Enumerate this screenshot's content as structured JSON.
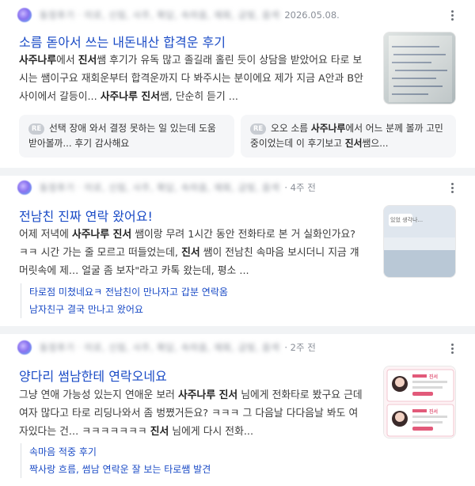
{
  "results": [
    {
      "meta_blurred": "동정후기 · 미로, 신림, 사주, 확답, 속마음, 재회, 금빛, 음색",
      "date": "2026.05.08.",
      "title": "소름 돋아서 쓰는 내돈내산 합격운 후기",
      "snippet": [
        {
          "b": "사주나루"
        },
        {
          "t": "에서 "
        },
        {
          "b": "진서"
        },
        {
          "t": "쌤 후기가 유독 많고 졸길래 홀린 듯이 상담을 받았어요 타로 보시는 쌤이구요 재회운부터 합격운까지 다 봐주시는 분이에요 제가 지금 A안과 B안 사이에서 갈등이... "
        },
        {
          "b": "사주나루 진서"
        },
        {
          "t": "쌤, 단순히 듣기 ..."
        }
      ],
      "replies": [
        {
          "tag": "RE",
          "parts": [
            {
              "t": "선택 장애 와서 결정 못하는 일 있는데 도움 받아볼까... 후기 감사해요"
            }
          ]
        },
        {
          "tag": "RE",
          "parts": [
            {
              "t": "오오 소름 "
            },
            {
              "b": "사주나루"
            },
            {
              "t": "에서 어느 분께 볼까 고민 중이었는데 이 후기보고 "
            },
            {
              "b": "진서"
            },
            {
              "t": "쌤으..."
            }
          ]
        }
      ]
    },
    {
      "meta_blurred": "동정후기 · 미로, 신림, 사주, 확답, 속마음, 재회, 금빛, 음색",
      "date": "· 4주 전",
      "title": "전남친 진짜 연락 왔어요!",
      "snippet": [
        {
          "t": "어제 저녁에 "
        },
        {
          "b": "사주나루 진서"
        },
        {
          "t": " 쌤이랑 무려 1시간 동안 전화타로 본 거 실화인가요? ㅋㅋ 시간 가는 줄 모르고 떠들었는데, "
        },
        {
          "b": "진서"
        },
        {
          "t": " 쌤이 전남친 속마음 보시더니 지금 걔 머릿속에 제... 얼굴 좀 보자\"라고 카톡 왔는데, 평소 ..."
        }
      ],
      "thumb_caption": "있었 생각나...",
      "sublinks": [
        "타로점 미쳤네요ㅋ 전남친이 만나자고 갑분 연락옴",
        "남자친구 결국 만나고 왔어요"
      ]
    },
    {
      "meta_blurred": "동정후기 · 미로, 신림, 사주, 확답, 속마음, 재회, 금빛, 음색",
      "date": "· 2주 전",
      "title": "양다리 썸남한테 연락오네요",
      "snippet": [
        {
          "t": "그냥 연애 가능성 있는지 연애운 보러 "
        },
        {
          "b": "사주나루 진서"
        },
        {
          "t": " 님에게 전화타로 봤구요 근데 여자 많다고 타로 리딩나와서 좀 벙쪘거든요? ㅋㅋㅋ 그 다음날 다다음날 봐도 여자있다는 건... ㅋㅋㅋㅋㅋㅋㅋ "
        },
        {
          "b": "진서"
        },
        {
          "t": " 님에게 다시 전화..."
        }
      ],
      "profile_name": "진서",
      "sublinks": [
        "속마음 적중 후기",
        "짝사랑 흐름, 썸남 연락운 잘 보는 타로쌤 발견"
      ]
    }
  ]
}
